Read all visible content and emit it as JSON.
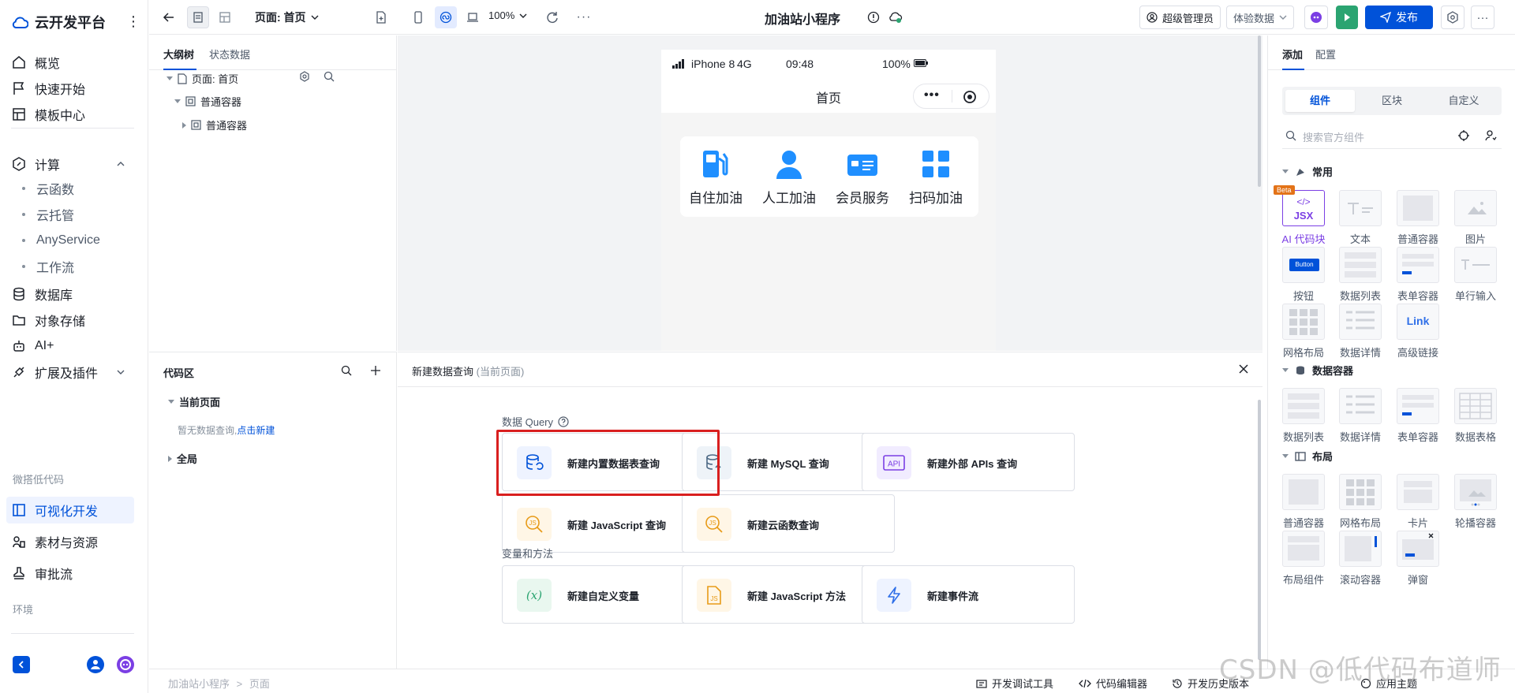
{
  "brand": {
    "name": "云开发平台"
  },
  "nav": {
    "overview": "概览",
    "quickstart": "快速开始",
    "templates": "模板中心",
    "compute": "计算",
    "compute_items": [
      "云函数",
      "云托管",
      "AnyService",
      "工作流"
    ],
    "database": "数据库",
    "storage": "对象存储",
    "ai": "AI+",
    "extensions": "扩展及插件",
    "group_lowcode": "微搭低代码",
    "visual_dev": "可视化开发",
    "assets": "素材与资源",
    "approval": "审批流",
    "env": "环境"
  },
  "topbar": {
    "page_selector": "页面: 首页",
    "zoom": "100%",
    "app_title": "加油站小程序",
    "user": "超级管理员",
    "data_mode": "体验数据",
    "publish": "发布"
  },
  "outline": {
    "tab_tree": "大纲树",
    "tab_state": "状态数据",
    "nodes": [
      "页面: 首页",
      "普通容器",
      "普通容器"
    ]
  },
  "phone": {
    "carrier": "iPhone 8",
    "network": "4G",
    "time": "09:48",
    "battery": "100%",
    "title": "首页",
    "services": [
      "自住加油",
      "人工加油",
      "会员服务",
      "扫码加油"
    ],
    "accent": "#1f8fff"
  },
  "code": {
    "title": "代码区",
    "current_page": "当前页面",
    "empty_text": "暂无数据查询,",
    "create_link": "点击新建",
    "global": "全局"
  },
  "query": {
    "title": "新建数据查询",
    "subtitle": "(当前页面)",
    "section_query": "数据 Query",
    "section_vars": "变量和方法",
    "cards": {
      "builtin_table": "新建内置数据表查询",
      "mysql": "新建 MySQL 查询",
      "external_api": "新建外部 APIs 查询",
      "javascript": "新建 JavaScript 查询",
      "cloud_function": "新建云函数查询",
      "custom_var": "新建自定义变量",
      "js_method": "新建 JavaScript 方法",
      "event_flow": "新建事件流"
    },
    "highlight_color": "#d91f1f"
  },
  "right": {
    "tab_add": "添加",
    "tab_config": "配置",
    "segments": [
      "组件",
      "区块",
      "自定义"
    ],
    "search_placeholder": "搜索官方组件",
    "group_common": "常用",
    "group_data": "数据容器",
    "group_layout": "布局",
    "common": [
      "AI 代码块",
      "文本",
      "普通容器",
      "图片",
      "按钮",
      "数据列表",
      "表单容器",
      "单行输入",
      "网格布局",
      "数据详情",
      "高级链接"
    ],
    "jsx_text": "JSX",
    "beta": "Beta",
    "button_thumb": "Button",
    "link_thumb": "Link",
    "data": [
      "数据列表",
      "数据详情",
      "表单容器",
      "数据表格"
    ],
    "layout": [
      "普通容器",
      "网格布局",
      "卡片",
      "轮播容器",
      "布局组件",
      "滚动容器",
      "弹窗"
    ]
  },
  "bottom": {
    "crumb_app": "加油站小程序",
    "crumb_page": "页面",
    "debug": "开发调试工具",
    "code_editor": "代码编辑器",
    "history": "开发历史版本",
    "theme": "应用主题"
  },
  "watermark": "CSDN @低代码布道师",
  "colors": {
    "primary": "#0052d9",
    "publish_green": "#2ba471"
  }
}
